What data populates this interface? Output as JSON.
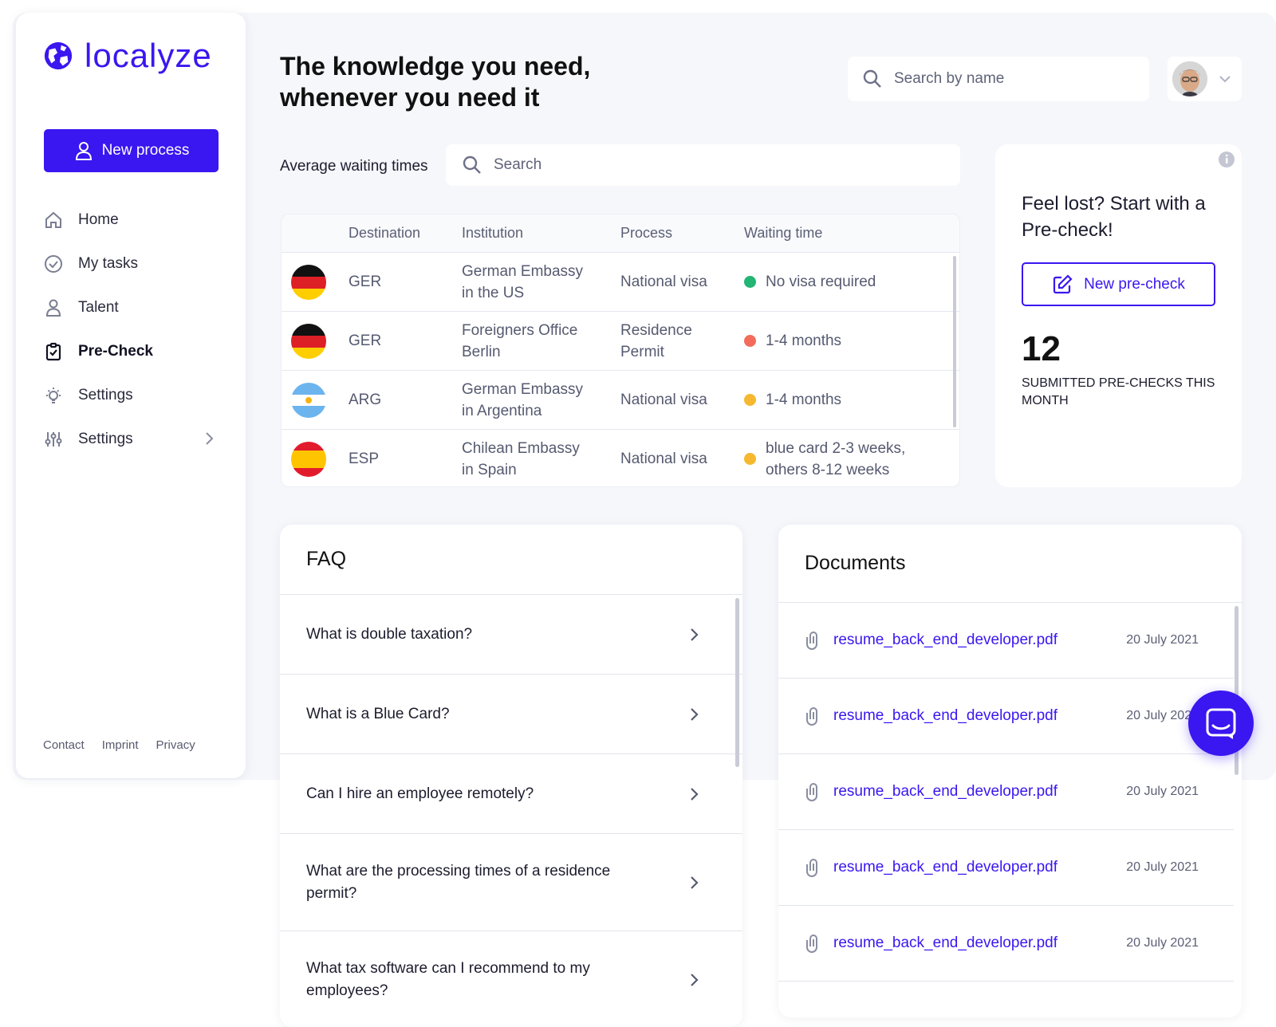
{
  "brand": {
    "name": "localyze",
    "color": "#3a16f0"
  },
  "sidebar": {
    "new_process_label": "New process",
    "items": [
      {
        "label": "Home",
        "icon": "home-icon"
      },
      {
        "label": "My tasks",
        "icon": "check-circle-icon"
      },
      {
        "label": "Talent",
        "icon": "user-icon"
      },
      {
        "label": "Pre-Check",
        "icon": "clipboard-check-icon",
        "active": true
      },
      {
        "label": "Settings",
        "icon": "lightbulb-icon"
      },
      {
        "label": "Settings",
        "icon": "sliders-icon",
        "has_chevron": true
      }
    ],
    "footer": [
      "Contact",
      "Imprint",
      "Privacy"
    ]
  },
  "header": {
    "headline_line1": "The knowledge you need,",
    "headline_line2": "whenever you need it",
    "search_placeholder": "Search by name"
  },
  "waiting_times": {
    "label": "Average waiting times",
    "search_placeholder": "Search",
    "columns": [
      "Destination",
      "Institution",
      "Process",
      "Waiting time"
    ],
    "rows": [
      {
        "flag": "germany",
        "destination": "GER",
        "institution_1": "German Embassy",
        "institution_2": "in the US",
        "process_1": "National visa",
        "process_2": "",
        "wait_1": "No visa required",
        "wait_2": "",
        "status_color": "#22b573"
      },
      {
        "flag": "germany",
        "destination": "GER",
        "institution_1": "Foreigners Office",
        "institution_2": "Berlin",
        "process_1": "Residence",
        "process_2": "Permit",
        "wait_1": "1-4 months",
        "wait_2": "",
        "status_color": "#f26b5b"
      },
      {
        "flag": "argentina",
        "destination": "ARG",
        "institution_1": "German Embassy",
        "institution_2": "in Argentina",
        "process_1": "National visa",
        "process_2": "",
        "wait_1": "1-4 months",
        "wait_2": "",
        "status_color": "#f5b82e"
      },
      {
        "flag": "spain",
        "destination": "ESP",
        "institution_1": "Chilean Embassy",
        "institution_2": "in Spain",
        "process_1": "National visa",
        "process_2": "",
        "wait_1": "blue card 2-3 weeks,",
        "wait_2": "others 8-12 weeks",
        "status_color": "#f5b82e"
      }
    ]
  },
  "precheck": {
    "title": "Feel lost? Start with a Pre-check!",
    "button_label": "New pre-check",
    "count": "12",
    "caption": "SUBMITTED PRE-CHECKS THIS MONTH"
  },
  "faq": {
    "title": "FAQ",
    "items": [
      "What is double taxation?",
      "What is a Blue Card?",
      "Can I hire an employee remotely?",
      "What are the processing times of a residence permit?",
      "What tax software can I recommend to my employees?"
    ]
  },
  "documents": {
    "title": "Documents",
    "items": [
      {
        "name": "resume_back_end_developer.pdf",
        "date": "20 July 2021"
      },
      {
        "name": "resume_back_end_developer.pdf",
        "date": "20 July 2021"
      },
      {
        "name": "resume_back_end_developer.pdf",
        "date": "20 July 2021"
      },
      {
        "name": "resume_back_end_developer.pdf",
        "date": "20 July 2021"
      },
      {
        "name": "resume_back_end_developer.pdf",
        "date": "20 July 2021"
      }
    ]
  }
}
